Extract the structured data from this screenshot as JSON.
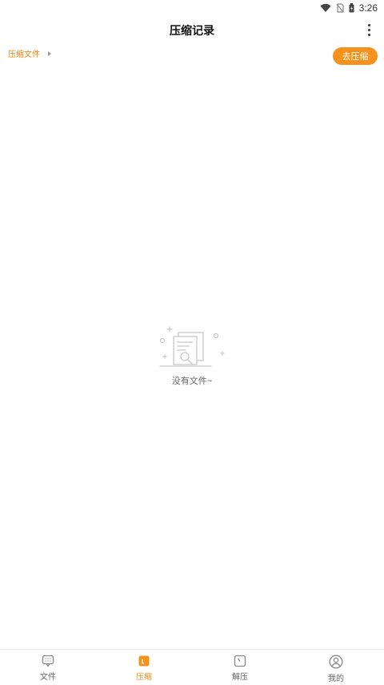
{
  "status_bar": {
    "time": "3:26"
  },
  "app_bar": {
    "title": "压缩记录"
  },
  "breadcrumb": {
    "label": "压缩文件"
  },
  "action": {
    "go_compress_label": "去压缩"
  },
  "empty_state": {
    "message": "没有文件~"
  },
  "bottom_nav": {
    "items": [
      {
        "label": "文件",
        "icon": "file-icon",
        "active": false
      },
      {
        "label": "压缩",
        "icon": "compress-icon",
        "active": true
      },
      {
        "label": "解压",
        "icon": "extract-icon",
        "active": false
      },
      {
        "label": "我的",
        "icon": "profile-icon",
        "active": false
      }
    ]
  },
  "colors": {
    "accent": "#f5921e",
    "breadcrumb": "#e8860f"
  }
}
